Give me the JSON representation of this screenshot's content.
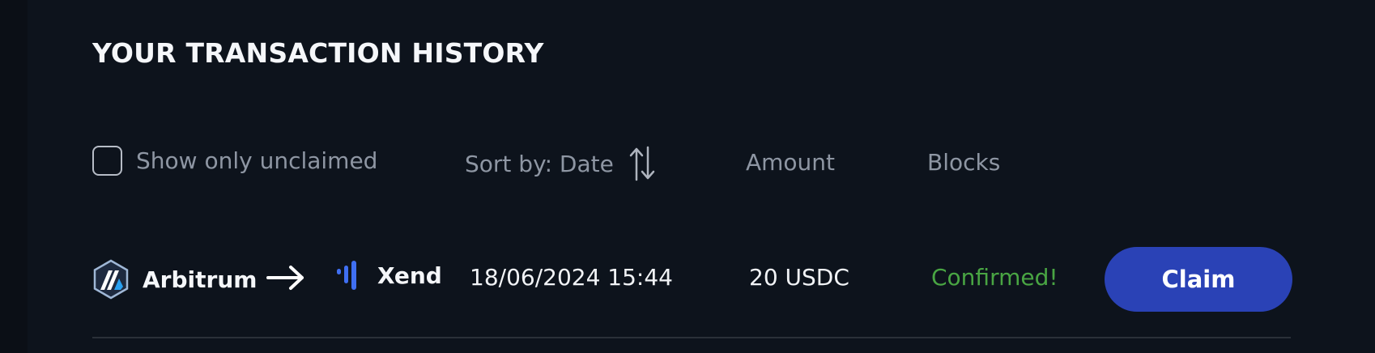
{
  "title": "YOUR TRANSACTION HISTORY",
  "filters": {
    "show_unclaimed_label": "Show only unclaimed",
    "show_unclaimed_checked": false,
    "sort_label": "Sort by: Date",
    "amount_header": "Amount",
    "blocks_header": "Blocks"
  },
  "transactions": [
    {
      "source_chain": "Arbitrum",
      "source_icon": "arbitrum-logo-icon",
      "arrow_icon": "right-arrow-icon",
      "destination_chain": "Xend",
      "destination_icon": "xend-logo-icon",
      "date": "18/06/2024 15:44",
      "amount": "20 USDC",
      "status": "Confirmed!",
      "action_label": "Claim"
    }
  ],
  "colors": {
    "background": "#0d131c",
    "status_confirmed": "#49a543",
    "claim_button": "#2a42b6"
  }
}
